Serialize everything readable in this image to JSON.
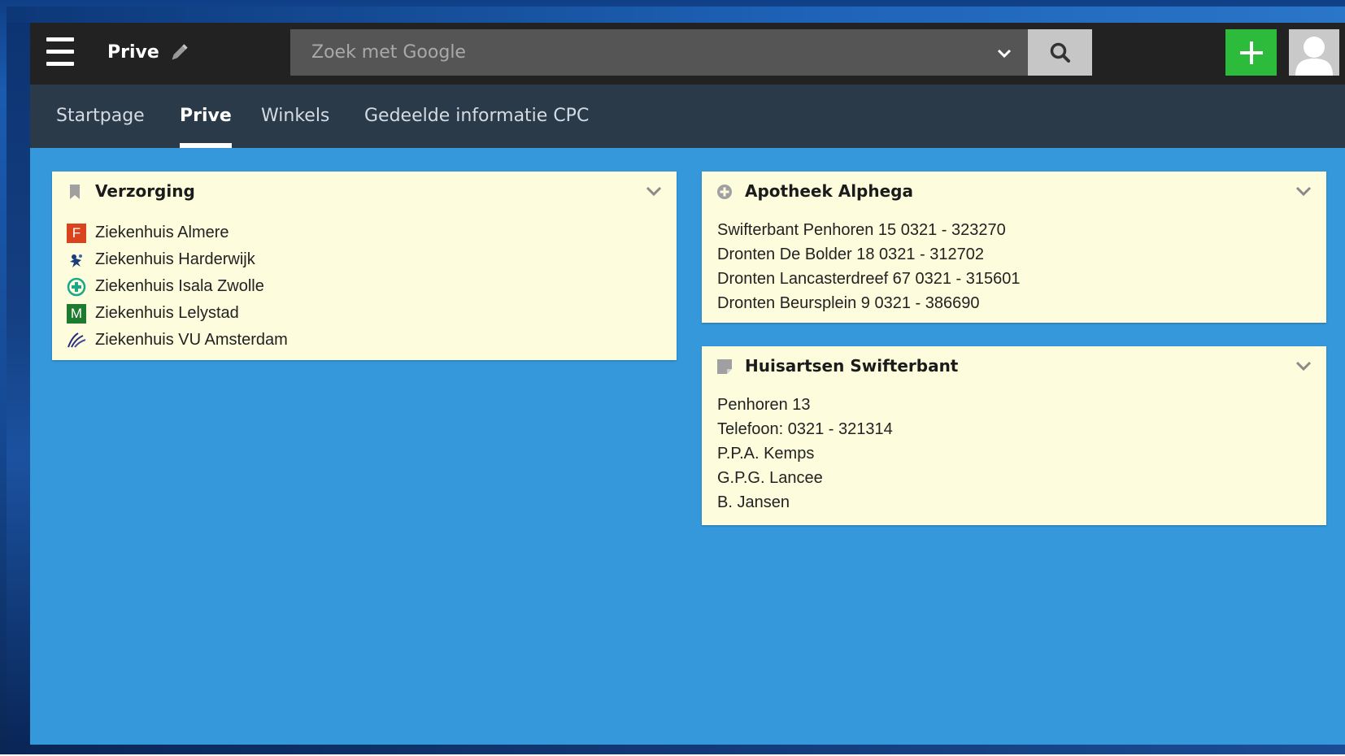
{
  "header": {
    "page_name": "Prive",
    "search": {
      "placeholder": "Zoek met Google",
      "value": ""
    },
    "colors": {
      "add_button": "#2dbb3c",
      "topbar": "#222222"
    }
  },
  "tabs": [
    {
      "label": "Startpage",
      "active": false
    },
    {
      "label": "Prive",
      "active": true
    },
    {
      "label": "Winkels",
      "active": false
    },
    {
      "label": "Gedeelde informatie CPC",
      "active": false
    }
  ],
  "widgets": {
    "verzorging": {
      "title": "Verzorging",
      "icon": "bookmark-icon",
      "links": [
        {
          "label": "Ziekenhuis Almere",
          "favicon": "F",
          "favicon_color": "#d9441e"
        },
        {
          "label": "Ziekenhuis Harderwijk",
          "favicon": "harderwijk-logo-icon"
        },
        {
          "label": "Ziekenhuis Isala Zwolle",
          "favicon": "isala-logo-icon"
        },
        {
          "label": "Ziekenhuis Lelystad",
          "favicon": "M",
          "favicon_color": "#1d7a2e"
        },
        {
          "label": "Ziekenhuis VU Amsterdam",
          "favicon": "vumc-logo-icon"
        }
      ]
    },
    "apotheek": {
      "title": "Apotheek Alphega",
      "icon": "plus-circle-icon",
      "lines": [
        "Swifterbant Penhoren 15 0321 - 323270",
        "Dronten De Bolder 18 0321 - 312702",
        "Dronten Lancasterdreef 67 0321 - 315601",
        "Dronten Beursplein 9 0321 - 386690"
      ]
    },
    "huisartsen": {
      "title": "Huisartsen Swifterbant",
      "icon": "note-icon",
      "lines": [
        "Penhoren 13",
        "Telefoon: 0321 - 321314",
        "P.P.A. Kemps",
        "G.P.G. Lancee",
        "B. Jansen"
      ]
    }
  }
}
